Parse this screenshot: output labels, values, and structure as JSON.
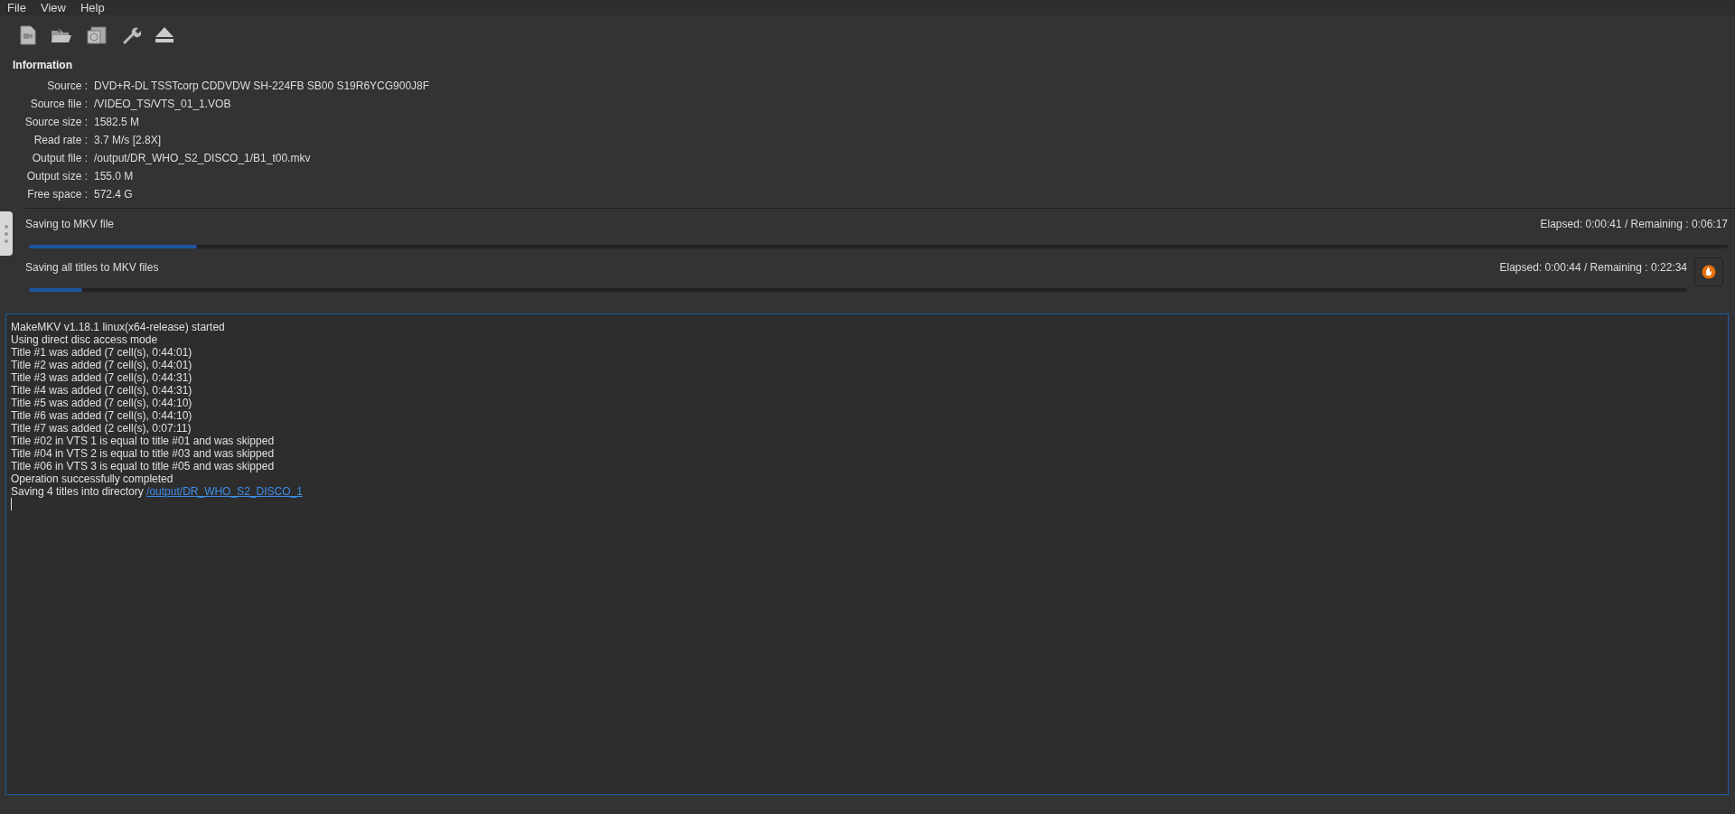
{
  "menu": [
    "File",
    "View",
    "Help"
  ],
  "toolbar": [
    {
      "kind": "video-file"
    },
    {
      "kind": "open-folder"
    },
    {
      "kind": "disc-backup"
    },
    {
      "kind": "wrench"
    },
    {
      "kind": "eject"
    }
  ],
  "information": {
    "title": "Information",
    "rows": [
      {
        "label": "Source :",
        "value": "DVD+R-DL TSSTcorp CDDVDW SH-224FB SB00 S19R6YCG900J8F"
      },
      {
        "label": "Source file :",
        "value": "/VIDEO_TS/VTS_01_1.VOB"
      },
      {
        "label": "Source size :",
        "value": "1582.5 M"
      },
      {
        "label": "Read rate :",
        "value": "3.7 M/s [2.8X]"
      },
      {
        "label": "Output file :",
        "value": "/output/DR_WHO_S2_DISCO_1/B1_t00.mkv"
      },
      {
        "label": "Output size :",
        "value": "155.0 M"
      },
      {
        "label": "Free space :",
        "value": "572.4 G"
      }
    ]
  },
  "progress": [
    {
      "label": "Saving to MKV file",
      "timing": "Elapsed: 0:00:41 / Remaining : 0:06:17",
      "level": 0.099,
      "stop_button": false
    },
    {
      "label": "Saving all titles to MKV files",
      "timing": "Elapsed: 0:00:44 / Remaining : 0:22:34",
      "level": 0.032,
      "stop_button": true
    }
  ],
  "log": [
    {
      "text": "MakeMKV v1.18.1 linux(x64-release) started"
    },
    {
      "text": "Using direct disc access mode"
    },
    {
      "text": "Title #1 was added (7 cell(s), 0:44:01)"
    },
    {
      "text": "Title #2 was added (7 cell(s), 0:44:01)"
    },
    {
      "text": "Title #3 was added (7 cell(s), 0:44:31)"
    },
    {
      "text": "Title #4 was added (7 cell(s), 0:44:31)"
    },
    {
      "text": "Title #5 was added (7 cell(s), 0:44:10)"
    },
    {
      "text": "Title #6 was added (7 cell(s), 0:44:10)"
    },
    {
      "text": "Title #7 was added (2 cell(s), 0:07:11)"
    },
    {
      "text": "Title #02 in VTS 1 is equal to title #01 and was skipped"
    },
    {
      "text": "Title #04 in VTS 2 is equal to title #03 and was skipped"
    },
    {
      "text": "Title #06 in VTS 3 is equal to title #05 and was skipped"
    },
    {
      "text": "Operation successfully completed"
    },
    {
      "text": "Saving 4 titles into directory",
      "link": "/output/DR_WHO_S2_DISCO_1"
    }
  ]
}
